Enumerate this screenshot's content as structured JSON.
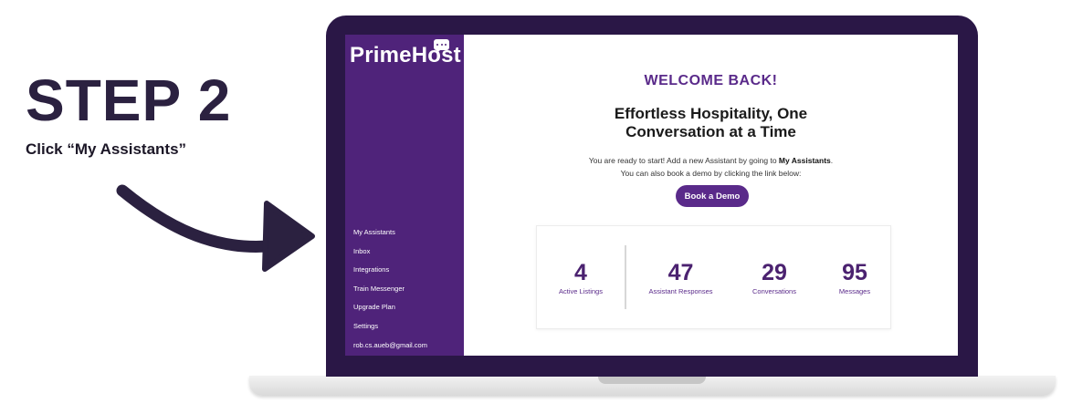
{
  "instruction": {
    "step": "STEP 2",
    "subtitle": "Click “My Assistants”"
  },
  "app": {
    "logo": "PrimeHost",
    "sidebar": {
      "items": [
        {
          "label": "My Assistants"
        },
        {
          "label": "Inbox"
        },
        {
          "label": "Integrations"
        },
        {
          "label": "Train Messenger"
        },
        {
          "label": "Upgrade Plan"
        },
        {
          "label": "Settings"
        },
        {
          "label": "rob.cs.aueb@gmail.com"
        }
      ]
    },
    "main": {
      "welcome": "WELCOME BACK!",
      "tagline_line1": "Effortless Hospitality, One",
      "tagline_line2": "Conversation at a Time",
      "desc_line1_pre": "You are ready to start! Add a new Assistant by going to ",
      "desc_line1_bold": "My Assistants",
      "desc_line1_post": ".",
      "desc_line2": "You can also book a demo by clicking the link below:",
      "demo_button": "Book a Demo",
      "stats": [
        {
          "value": "4",
          "label": "Active Listings"
        },
        {
          "value": "47",
          "label": "Assistant Responses"
        },
        {
          "value": "29",
          "label": "Conversations"
        },
        {
          "value": "95",
          "label": "Messages"
        }
      ]
    }
  },
  "colors": {
    "sidebar": "#4f237a",
    "accent": "#5a2a8a",
    "laptop_frame": "#2a1746",
    "step_text": "#2b2140"
  },
  "icons": {
    "arrow": "curved-arrow-icon",
    "logo_bubble": "chat-bubble-icon"
  }
}
